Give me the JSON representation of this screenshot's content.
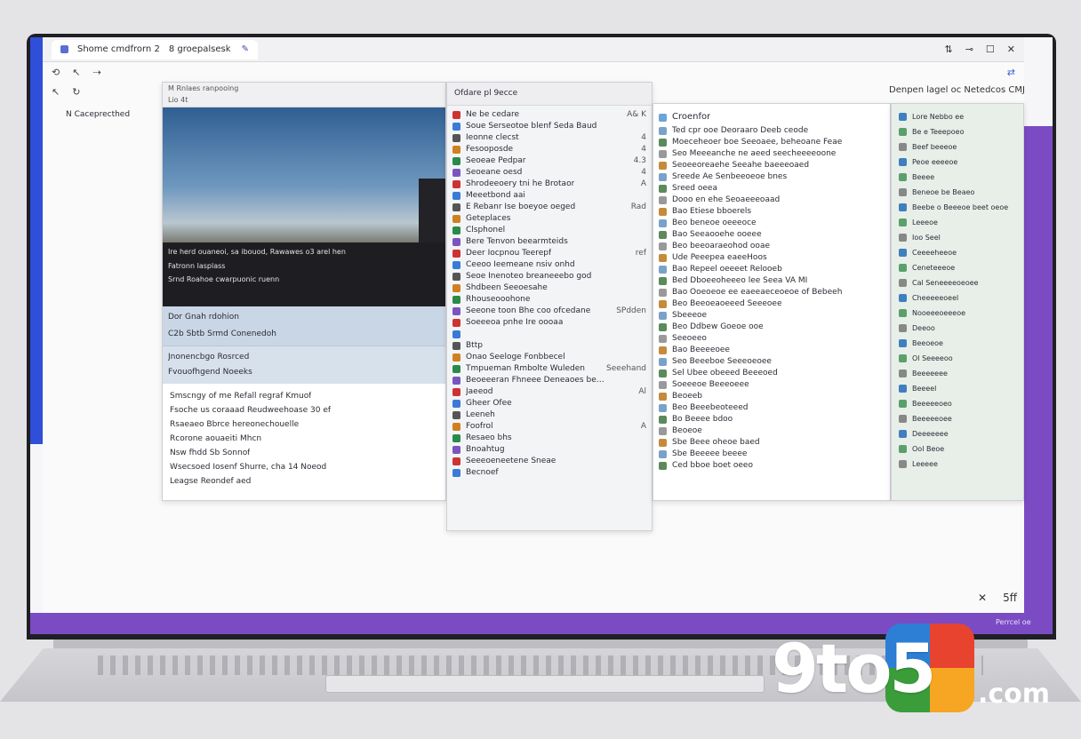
{
  "window": {
    "tab1_label": "Shome cmdfrorn 2",
    "tab2_label": "8 groepalsesk",
    "controls": [
      "⇅",
      "⊸",
      "☐",
      "✕"
    ]
  },
  "toolbar": {
    "items": [
      "⟲",
      "↖",
      "⇢"
    ],
    "items2": [
      "↖",
      "↻"
    ]
  },
  "sidebar": {
    "label": "N Caceprecthed"
  },
  "topright_label": "Denpen lagel oc Netedcos CMJ",
  "panel1": {
    "header_lines": [
      "M  Rnlaes ranpooing",
      "Lio 4t"
    ],
    "video_caption_1": "Ire herd ouaneoi, sa ibouod, Rawawes o3 arel hen",
    "video_caption_2": "Fatronn lasplass",
    "video_caption_3": "Srnd Roahoe cwarpuonic ruenn",
    "selected_rows": [
      "Dor  Gnah rdohion",
      "C2b  Sbtb Srmd Conenedoh"
    ],
    "section_rows": [
      "Jnonencbgo  Rosrced",
      "Fvouofhgend Noeeks"
    ],
    "list_title": "Smscngy of me Refall regraf Kmuof",
    "list_items": [
      "Fsoche us coraaad Reudweehoase 30 ef",
      "Rsaeaeo  Bbrce  hereonechouelle",
      "Rcorone aouaeiti Mhcn",
      "Nsw fhdd Sb Sonnof",
      "Wsecsoed Iosenf Shurre, cha 14 Noeod",
      "Leagse Reondef aed"
    ]
  },
  "panel2": {
    "header": "Ofdare pl 9ecce",
    "items": [
      {
        "label": "Ne  be cedare",
        "value": "A& K"
      },
      {
        "label": "Soue  Serseotoe blenf Seda  Baud",
        "value": ""
      },
      {
        "label": "Ieonne clecst",
        "value": "4"
      },
      {
        "label": "Fesooposde",
        "value": "4"
      },
      {
        "label": "Seoeae Pedpar",
        "value": "4.3"
      },
      {
        "label": "Seoeane oesd",
        "value": "4"
      },
      {
        "label": "Shrodeeoery tni he Brotaor",
        "value": "A"
      },
      {
        "label": "Meeetbond aai",
        "value": ""
      },
      {
        "label": "E Rebanr Ise boeyoe oeged",
        "value": "Rad"
      },
      {
        "label": "Geteplaces",
        "value": ""
      },
      {
        "label": "Clsphonel",
        "value": ""
      },
      {
        "label": "Bere Tenvon beearmteids",
        "value": ""
      },
      {
        "label": "Deer Iocpnou Teerepf",
        "value": "ref"
      },
      {
        "label": "Ceeoo Ieemeane nsiv onhd",
        "value": ""
      },
      {
        "label": "Seoe  Inenoteo breaneeebo god",
        "value": ""
      },
      {
        "label": "Shdbeen Seeoesahe",
        "value": ""
      },
      {
        "label": "Rhouseooohone",
        "value": ""
      },
      {
        "label": "Seeone toon Bhe coo ofcedane",
        "value": "SPdden"
      },
      {
        "label": "Soeeeoa pnhe Ire oooaa",
        "value": ""
      },
      {
        "label": "",
        "value": ""
      },
      {
        "label": "Bttp",
        "value": ""
      },
      {
        "label": "Onao Seeloge Fonbbecel",
        "value": ""
      },
      {
        "label": "Tmpueman Rmbolte Wuleden",
        "value": "Seeehand"
      },
      {
        "label": "Beoeeeran Fhneee Deneaoes beolfy",
        "value": ""
      },
      {
        "label": "Jaeeod",
        "value": "Al"
      },
      {
        "label": "Gheer Ofee",
        "value": ""
      },
      {
        "label": "Leeneh",
        "value": ""
      },
      {
        "label": "Foofrol",
        "value": "A"
      },
      {
        "label": "Resaeo bhs",
        "value": ""
      },
      {
        "label": "Bnoahtug",
        "value": ""
      },
      {
        "label": "Seeeoeneetene Sneae",
        "value": ""
      },
      {
        "label": "Becnoef",
        "value": ""
      }
    ]
  },
  "panel3": {
    "header": "Croenfor",
    "items": [
      "Ted cpr ooe Deoraaro Deeb ceode",
      "Moeceheoer boe Seeoaee, beheoane Feae",
      "Seo Meeeanche ne aeed seecheeeeoone",
      "Seoeeoreaehe Seeahe baeeeoaed",
      "Sreede Ae Senbeeoeoe bnes",
      "Sreed oeea",
      "Dooo  en ehe Seoaeeeoaad",
      "Bao  Etiese bboerels",
      "Beo beneoe oeeeoce",
      "Bao Seeaooehe ooeee",
      "Beo  beeoaraeohod ooae",
      "Ude Peeepea eaeeHoos",
      "Bao  Repeel oeeeet Relooeb",
      "Bed  Dboeeoheeeo lee Seea VA MI",
      "Bao  Ooeoeoe ee eaeeaeceoeoe of Bebeeh",
      "Beo  Beeoeaoeeed Seeeoee",
      "Sbeeeoe",
      "Beo Ddbew Goeoe ooe",
      "Seeoeeo",
      "Bao Beeeeoee",
      "Seo Beeeboe Seeeoeoee",
      "Sel  Ubee obeeed Beeeoed",
      "Soeeeoe Beeeoeee",
      "Beoeeb",
      "Beo Beeebeoteeed",
      "Bo Beeee bdoo",
      "Beoeoe",
      "Sbe  Beee oheoe baed",
      "Sbe  Beeeee beeee",
      "Ced  bboe boet oeeo"
    ]
  },
  "panel4": {
    "items": [
      "Lore Nebbo ee",
      "Be e Teeepoeo",
      "Beef beeeoe",
      "Peoe eeeeoe",
      "Beeee",
      "Beneoe be Beaeo",
      "Beebe o Beeeoe beet oeoe",
      "Leeeoe",
      "Ioo Seel",
      "Ceeeeheeoe",
      "Ceneteeeoe",
      "Cal Seneeeeoeoee",
      "Cheeeeeoeel",
      "Nooeeeoeeeoe",
      "Deeoo",
      "Beeoeoe",
      "Ol Seeeeoo",
      "Beeeeeee",
      "Beeeel",
      "Beeeeeoeo",
      "Beeeeeoee",
      "Deeeeeee",
      "Ool Beoe",
      "Leeeee"
    ]
  },
  "bottom_icons": [
    "✕",
    "5ff"
  ],
  "corner_text": "Perrcel oe",
  "logo": {
    "text": "9to5",
    "suffix": ".com"
  },
  "colors": {
    "accent_blue": "#2f4fd8",
    "accent_purple": "#7b4bc4"
  }
}
